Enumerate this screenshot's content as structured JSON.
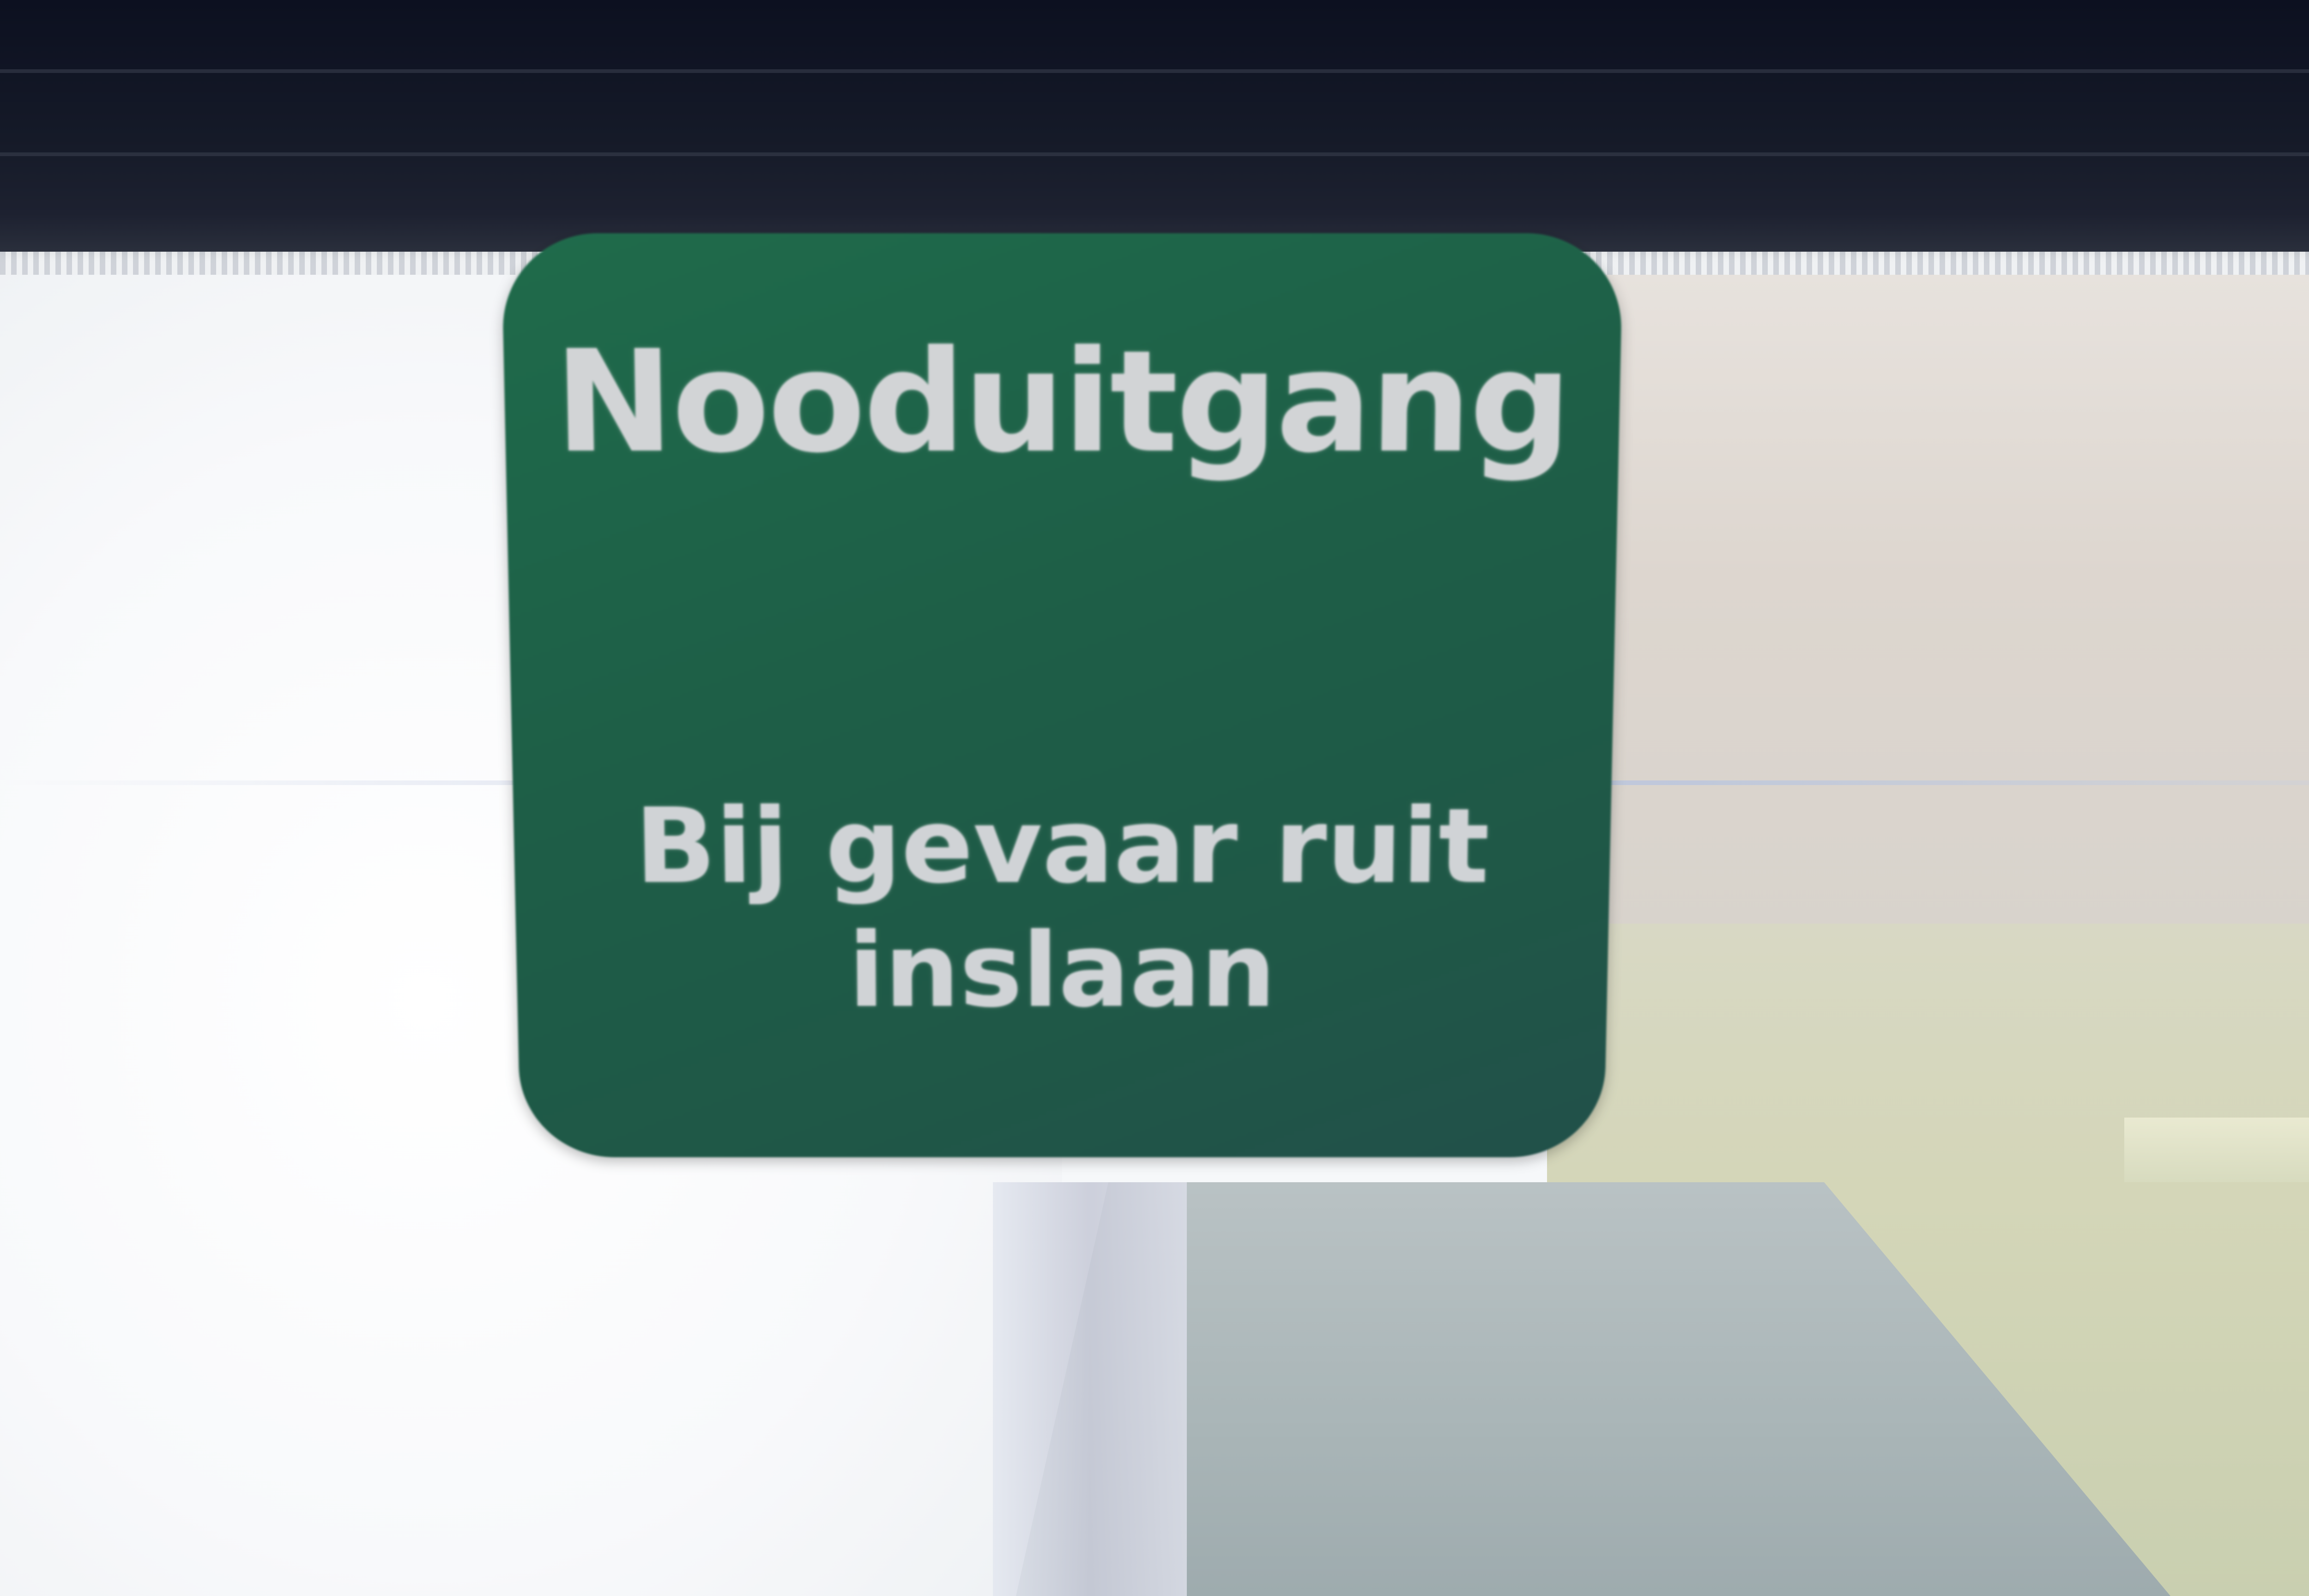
{
  "sign": {
    "title": "Nooduitgang",
    "instruction_line1": "Bij gevaar ruit",
    "instruction_line2": "inslaan",
    "background_color": "#1f5e47",
    "text_color": "#d2d4d6"
  }
}
